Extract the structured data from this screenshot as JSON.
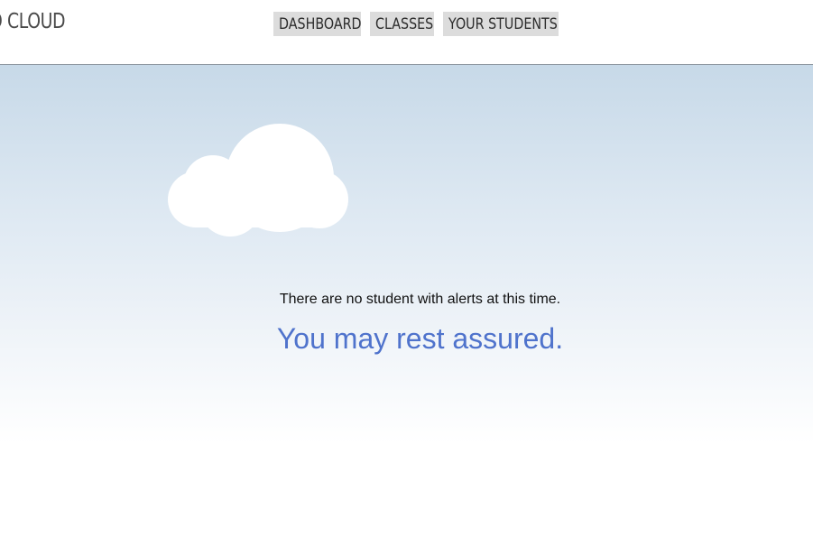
{
  "header": {
    "logo_text": "O CLOUD",
    "nav": [
      {
        "label": "DASHBOARD"
      },
      {
        "label": "CLASSES"
      },
      {
        "label": "YOUR STUDENTS"
      }
    ]
  },
  "main": {
    "icon": "cloud-icon",
    "message": "There are no student with alerts at this time.",
    "reassurance": "You may rest assured."
  },
  "colors": {
    "accent": "#4f73cc",
    "nav_bg": "#dcdcdc",
    "sky_top": "#c7d9e8"
  }
}
